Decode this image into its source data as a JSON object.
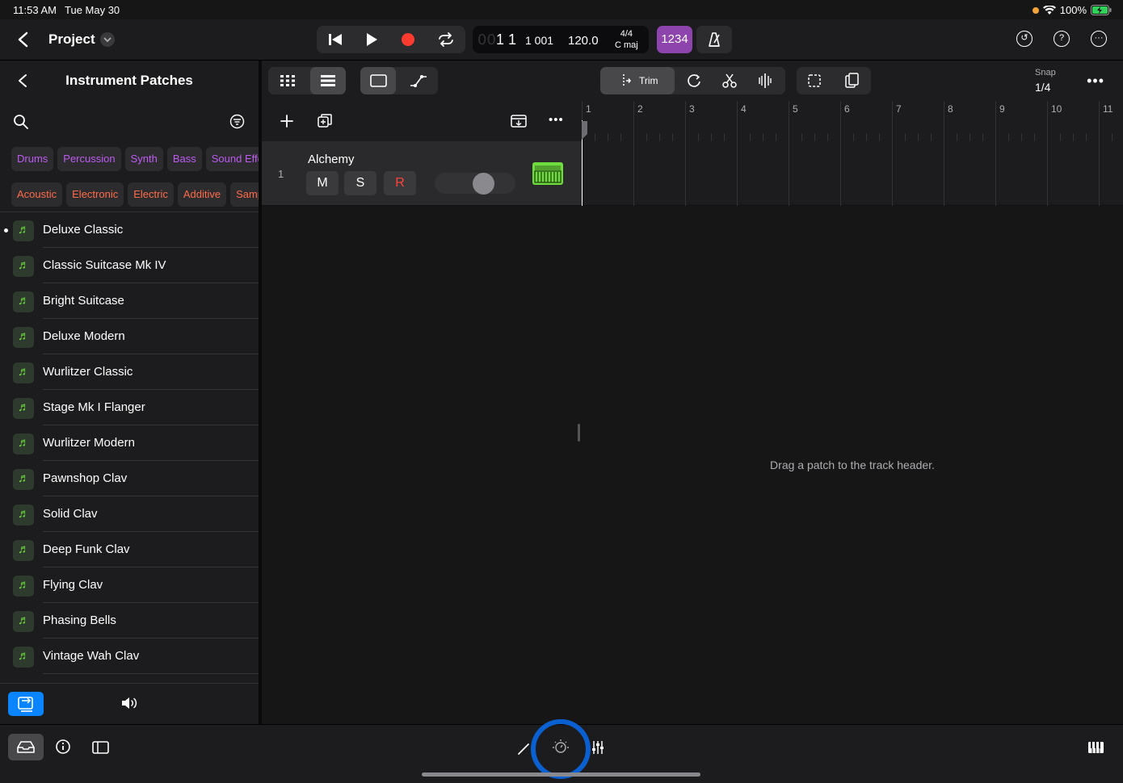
{
  "status_bar": {
    "time": "11:53 AM",
    "date": "Tue May 30",
    "battery": "100%"
  },
  "header": {
    "project_title": "Project",
    "lcd": {
      "position_dim": "00",
      "position": "1 1",
      "sub_position": "1 001",
      "tempo": "120.0",
      "time_signature": "4/4",
      "key": "C maj"
    },
    "count_in": "1234"
  },
  "sidebar": {
    "title": "Instrument Patches",
    "chips_row1": [
      "Drums",
      "Percussion",
      "Synth",
      "Bass",
      "Sound Effects"
    ],
    "chips_row2": [
      "Acoustic",
      "Electronic",
      "Electric",
      "Additive",
      "Sampled"
    ],
    "patches": [
      "Deluxe Classic",
      "Classic Suitcase Mk IV",
      "Bright Suitcase",
      "Deluxe Modern",
      "Wurlitzer Classic",
      "Stage Mk I Flanger",
      "Wurlitzer Modern",
      "Pawnshop Clav",
      "Solid Clav",
      "Deep Funk Clav",
      "Flying Clav",
      "Phasing Bells",
      "Vintage Wah Clav"
    ],
    "active_patch_index": 0
  },
  "toolbar": {
    "trim_label": "Trim",
    "snap_label": "Snap",
    "snap_value": "1/4"
  },
  "track": {
    "number": "1",
    "name": "Alchemy",
    "mute": "M",
    "solo": "S",
    "record": "R",
    "volume": 0.65
  },
  "ruler": {
    "bars": [
      "1",
      "2",
      "3",
      "4",
      "5",
      "6",
      "7",
      "8",
      "9",
      "10",
      "11"
    ]
  },
  "timeline": {
    "empty_message": "Drag a patch to the track header."
  },
  "colors": {
    "accent_purple": "#bf5af2",
    "accent_red": "#ff6b4a",
    "instrument_green": "#6fdc3d",
    "record_red": "#ff3b30",
    "selection_blue": "#0a84ff",
    "count_in_purple": "#8e44ad"
  }
}
